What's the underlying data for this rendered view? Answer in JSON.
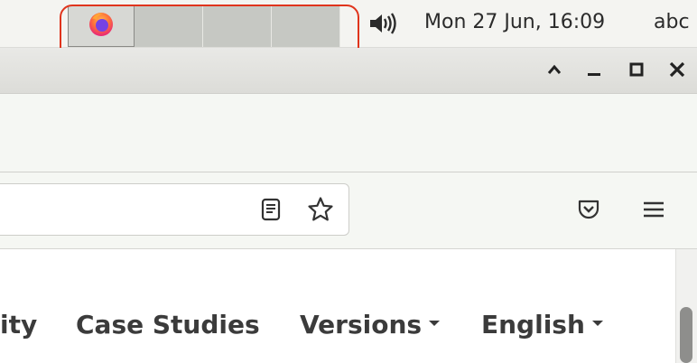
{
  "panel": {
    "clock": "Mon 27 Jun, 16:09",
    "user": "abc",
    "taskbar": {
      "items": [
        {
          "icon": "firefox-icon",
          "active": true
        },
        {
          "icon": "",
          "active": false
        },
        {
          "icon": "",
          "active": false
        },
        {
          "icon": "",
          "active": false
        }
      ]
    },
    "volume_icon": "volume-icon"
  },
  "window": {
    "controls": [
      "chevron-up-icon",
      "minimize-icon",
      "maximize-icon",
      "close-icon"
    ]
  },
  "navbar": {
    "icons": [
      "reader-view-icon",
      "bookmark-star-icon",
      "pocket-icon",
      "hamburger-menu-icon"
    ]
  },
  "page": {
    "nav_links": [
      {
        "label": "ity"
      },
      {
        "label": "Case Studies"
      },
      {
        "label": "Versions",
        "dropdown": true
      },
      {
        "label": "English",
        "dropdown": true
      }
    ]
  },
  "colors": {
    "highlight": "#e0341c",
    "panel": "#f4f4f1",
    "text": "#3b3b3b"
  }
}
